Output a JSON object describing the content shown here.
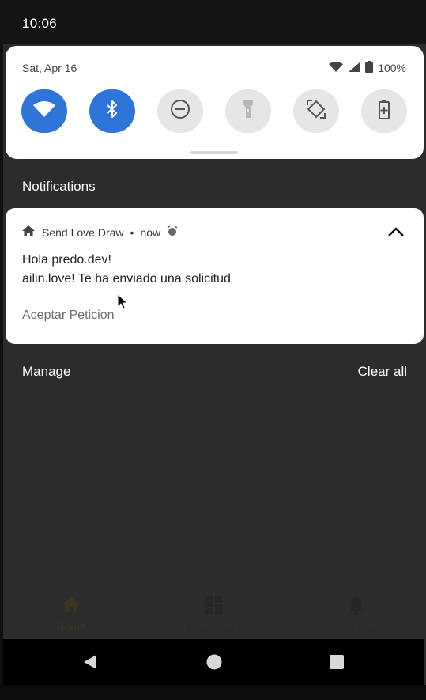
{
  "status_bar": {
    "time": "10:06"
  },
  "quick_settings": {
    "date": "Sat, Apr 16",
    "battery": "100%",
    "tiles": [
      {
        "name": "wifi",
        "icon": "wifi-icon",
        "active": true
      },
      {
        "name": "bluetooth",
        "icon": "bluetooth-icon",
        "active": true
      },
      {
        "name": "do-not-disturb",
        "icon": "do-not-disturb-icon",
        "active": false
      },
      {
        "name": "flashlight",
        "icon": "flashlight-icon",
        "active": false
      },
      {
        "name": "auto-rotate",
        "icon": "auto-rotate-icon",
        "active": false
      },
      {
        "name": "battery-saver",
        "icon": "battery-saver-icon",
        "active": false
      }
    ],
    "colors": {
      "active": "#2f75d9",
      "inactive": "#e6e6e6"
    }
  },
  "notifications": {
    "header": "Notifications",
    "items": [
      {
        "app_name": "Send Love Draw",
        "time": "now",
        "title": "Hola predo.dev!",
        "text": "ailin.love! Te ha enviado una solicitud",
        "action": "Aceptar Peticion"
      }
    ],
    "manage_label": "Manage",
    "clear_all_label": "Clear all"
  },
  "app_nav": {
    "items": [
      {
        "label": "Home",
        "icon": "home-icon",
        "active": true
      },
      {
        "label": "Dashboard",
        "icon": "dashboard-icon",
        "active": false
      },
      {
        "label": "Notifications",
        "icon": "bell-icon",
        "active": false
      }
    ]
  },
  "system_nav": {
    "buttons": [
      "back-icon",
      "home-circle-icon",
      "recents-icon"
    ]
  }
}
